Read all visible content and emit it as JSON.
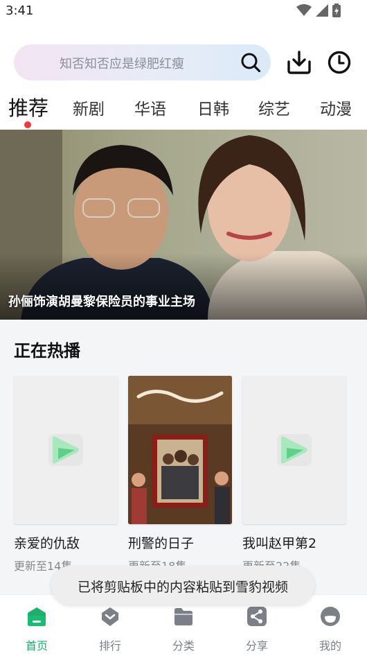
{
  "status_bar": {
    "time": "3:41"
  },
  "search": {
    "placeholder": "知否知否应是绿肥红瘦"
  },
  "tabs": [
    {
      "label": "推荐",
      "active": true
    },
    {
      "label": "新剧"
    },
    {
      "label": "华语"
    },
    {
      "label": "日韩"
    },
    {
      "label": "综艺"
    },
    {
      "label": "动漫"
    }
  ],
  "banner": {
    "caption": "孙俪饰演胡曼黎保险员的事业主场"
  },
  "section": {
    "title": "正在热播"
  },
  "cards": [
    {
      "title": "亲爱的仇敌",
      "subtitle": "更新至14集",
      "poster": "placeholder-logo"
    },
    {
      "title": "刑警的日子",
      "subtitle": "更新至18集",
      "poster": "poster-image"
    },
    {
      "title": "我叫赵甲第2",
      "subtitle": "更新至22集",
      "poster": "placeholder-logo"
    }
  ],
  "toast": {
    "text": "已将剪贴板中的内容粘贴到雪豹视频"
  },
  "bottom_nav": [
    {
      "label": "首页",
      "icon": "home-icon",
      "active": true
    },
    {
      "label": "排行",
      "icon": "ranking-icon"
    },
    {
      "label": "分类",
      "icon": "folder-icon"
    },
    {
      "label": "分享",
      "icon": "share-icon"
    },
    {
      "label": "我的",
      "icon": "profile-icon"
    }
  ],
  "colors": {
    "accent": "#1fae6b",
    "tab_indicator": "#f03a3a",
    "inactive_nav": "#7b7f87"
  }
}
